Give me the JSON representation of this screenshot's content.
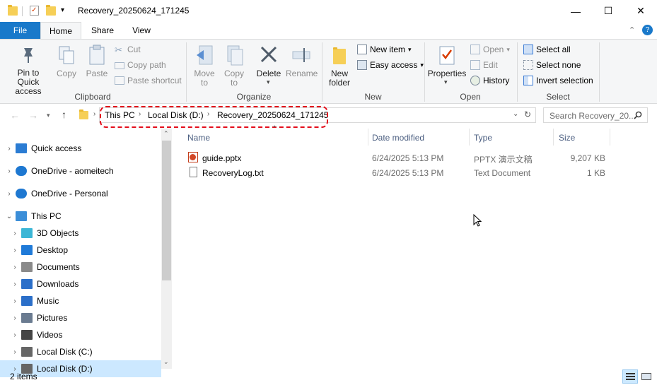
{
  "window": {
    "title": "Recovery_20250624_171245",
    "minimize": "—",
    "maximize": "☐",
    "close": "✕"
  },
  "tabs": {
    "file": "File",
    "home": "Home",
    "share": "Share",
    "view": "View"
  },
  "ribbon": {
    "clipboard": {
      "label": "Clipboard",
      "pin": "Pin to Quick access",
      "copy": "Copy",
      "paste": "Paste",
      "cut": "Cut",
      "copy_path": "Copy path",
      "paste_shortcut": "Paste shortcut"
    },
    "organize": {
      "label": "Organize",
      "move_to": "Move to",
      "copy_to": "Copy to",
      "delete": "Delete",
      "rename": "Rename"
    },
    "new": {
      "label": "New",
      "new_folder": "New folder",
      "new_item": "New item",
      "easy_access": "Easy access"
    },
    "open": {
      "label": "Open",
      "properties": "Properties",
      "open": "Open",
      "edit": "Edit",
      "history": "History"
    },
    "select": {
      "label": "Select",
      "select_all": "Select all",
      "select_none": "Select none",
      "invert": "Invert selection"
    }
  },
  "address": {
    "crumbs": [
      "This PC",
      "Local Disk (D:)",
      "Recovery_20250624_171245"
    ],
    "search_placeholder": "Search Recovery_20..."
  },
  "nav": [
    {
      "label": "Quick access",
      "icon": "star-icon"
    },
    {
      "label": "OneDrive - aomeitech",
      "icon": "cloud-icon"
    },
    {
      "label": "OneDrive - Personal",
      "icon": "cloud-icon"
    },
    {
      "label": "This PC",
      "icon": "computer-icon"
    },
    {
      "label": "3D Objects",
      "icon": "cube-icon"
    },
    {
      "label": "Desktop",
      "icon": "desktop-icon"
    },
    {
      "label": "Documents",
      "icon": "document-icon"
    },
    {
      "label": "Downloads",
      "icon": "download-icon"
    },
    {
      "label": "Music",
      "icon": "music-icon"
    },
    {
      "label": "Pictures",
      "icon": "picture-icon"
    },
    {
      "label": "Videos",
      "icon": "video-icon"
    },
    {
      "label": "Local Disk (C:)",
      "icon": "drive-icon"
    },
    {
      "label": "Local Disk (D:)",
      "icon": "drive-icon"
    }
  ],
  "columns": {
    "name": "Name",
    "date": "Date modified",
    "type": "Type",
    "size": "Size"
  },
  "files": [
    {
      "name": "guide.pptx",
      "date": "6/24/2025 5:13 PM",
      "type": "PPTX 演示文稿",
      "size": "9,207 KB",
      "icon": "pptx-icon"
    },
    {
      "name": "RecoveryLog.txt",
      "date": "6/24/2025 5:13 PM",
      "type": "Text Document",
      "size": "1 KB",
      "icon": "txt-icon"
    }
  ],
  "status": {
    "count": "2 items"
  },
  "colors": {
    "accent": "#1979ca",
    "highlight": "#e30d1a",
    "selected": "#cce8ff"
  }
}
